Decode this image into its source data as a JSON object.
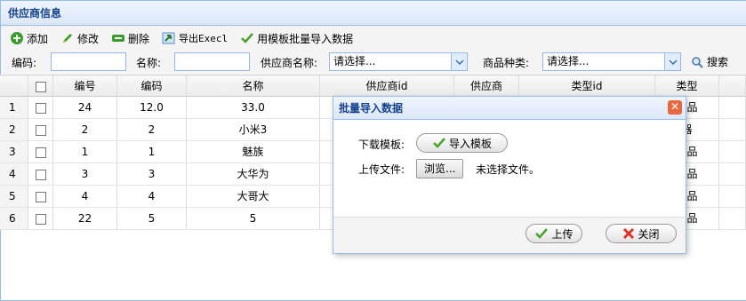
{
  "panel": {
    "title": "供应商信息"
  },
  "toolbar": {
    "add": "添加",
    "edit": "修改",
    "delete": "删除",
    "export": "导出Execl",
    "import": "用模板批量导入数据"
  },
  "filter": {
    "code_label": "编码:",
    "name_label": "名称:",
    "supplier_label": "供应商名称:",
    "category_label": "商品种类:",
    "supplier_value": "请选择...",
    "category_value": "请选择...",
    "search": "搜索"
  },
  "grid": {
    "headers": [
      "编号",
      "编码",
      "名称",
      "供应商id",
      "供应商",
      "类型id",
      "类型"
    ],
    "rows": [
      {
        "rn": "1",
        "id": "24",
        "code": "12.0",
        "name": "33.0",
        "type": "产品"
      },
      {
        "rn": "2",
        "id": "2",
        "code": "2",
        "name": "小米3",
        "type": "器"
      },
      {
        "rn": "3",
        "id": "1",
        "code": "1",
        "name": "魅族",
        "type": "产品"
      },
      {
        "rn": "4",
        "id": "3",
        "code": "3",
        "name": "大华为",
        "type": "产品"
      },
      {
        "rn": "5",
        "id": "4",
        "code": "4",
        "name": "大哥大",
        "type": "产品"
      },
      {
        "rn": "6",
        "id": "22",
        "code": "5",
        "name": "5",
        "type": "产品"
      }
    ]
  },
  "dialog": {
    "title": "批量导入数据",
    "download_label": "下载模板:",
    "download_button": "导入模板",
    "upload_label": "上传文件:",
    "browse_button": "浏览...",
    "no_file": "未选择文件。",
    "upload_button": "上传",
    "close_button": "关闭"
  }
}
